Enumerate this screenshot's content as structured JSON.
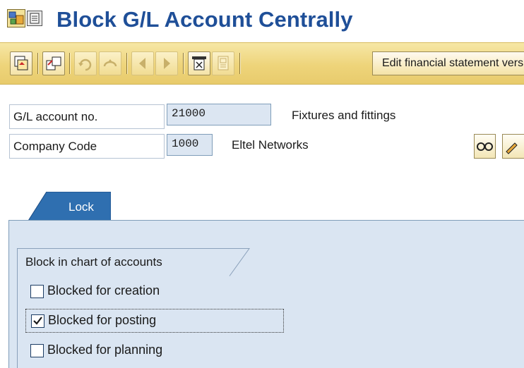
{
  "title": "Block G/L Account Centrally",
  "title_icons": [
    "transaction-icon",
    "menu-icon"
  ],
  "toolbar": {
    "buttons": [
      {
        "name": "switch-mode-icon",
        "enabled": true
      },
      {
        "name": "change-display-icon",
        "enabled": true
      },
      {
        "name": "undo-icon",
        "enabled": false
      },
      {
        "name": "redo-icon",
        "enabled": false
      },
      {
        "name": "previous-icon",
        "enabled": false
      },
      {
        "name": "next-icon",
        "enabled": false
      },
      {
        "name": "where-used-icon",
        "enabled": true
      },
      {
        "name": "document-icon",
        "enabled": false
      }
    ],
    "edit_fin_label": "Edit financial statement version"
  },
  "header": {
    "gl_label": "G/L account no.",
    "gl_value": "21000",
    "gl_desc": "Fixtures and fittings",
    "cc_label": "Company Code",
    "cc_value": "1000",
    "cc_desc": "Eltel Networks"
  },
  "tabs": [
    {
      "label": "Lock",
      "active": true
    }
  ],
  "group": {
    "title": "Block in chart of accounts",
    "options": [
      {
        "label": "Blocked for creation",
        "checked": false
      },
      {
        "label": "Blocked for posting",
        "checked": true,
        "focused": true
      },
      {
        "label": "Blocked for planning",
        "checked": false
      }
    ]
  },
  "colors": {
    "title": "#1f4f98",
    "toolbar": "#eed47a",
    "panel": "#dae5f2",
    "tab": "#2f6fb0"
  }
}
